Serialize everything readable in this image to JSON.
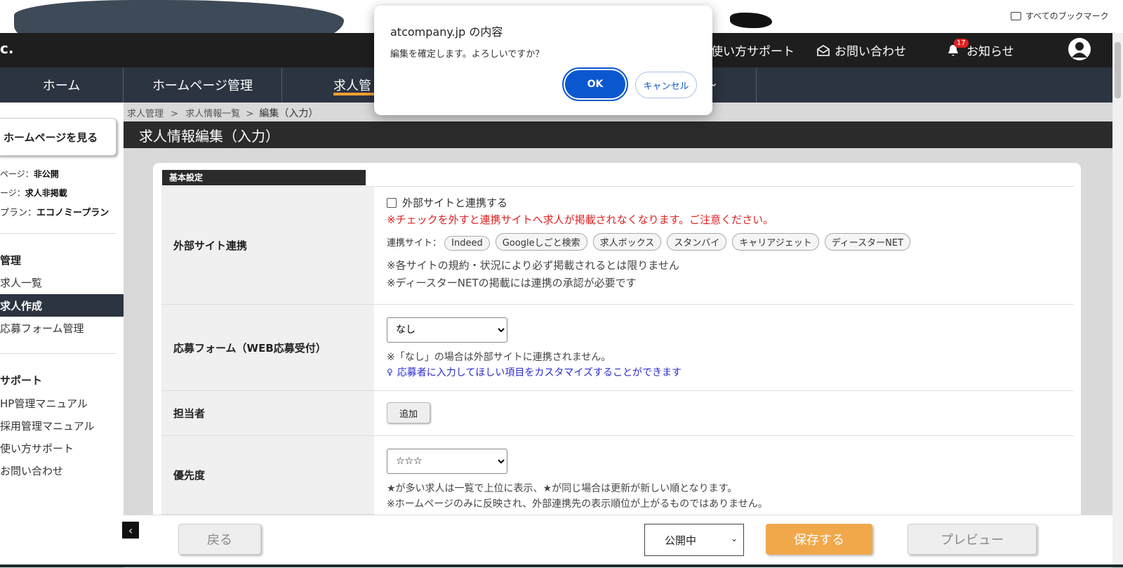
{
  "browser": {
    "bookmarks_label": "すべてのブックマーク"
  },
  "header": {
    "logo_fragment": "c.",
    "links": [
      {
        "label": "使い方サポート"
      },
      {
        "label": "お問い合わせ"
      },
      {
        "label": "お知らせ"
      }
    ],
    "notification_count": "17"
  },
  "nav": {
    "items": [
      "ホーム",
      "ホームページ管理",
      "求人管",
      "⌄"
    ]
  },
  "sidebar": {
    "view_homepage_button": "ホームページを見る",
    "status": [
      {
        "label": "ページ：",
        "value": "非公開"
      },
      {
        "label": "ージ：",
        "value": "求人非掲載"
      },
      {
        "label": "プラン：",
        "value": "エコノミープラン"
      }
    ],
    "section1_heading": "管理",
    "section1_items": [
      "求人一覧",
      "求人作成",
      "応募フォーム管理"
    ],
    "section2_heading": "サポート",
    "section2_items": [
      "HP管理マニュアル",
      "採用管理マニュアル",
      "使い方サポート",
      "お問い合わせ"
    ]
  },
  "main": {
    "breadcrumb": [
      "求人管理",
      ">",
      "求人情報一覧",
      ">",
      "編集（入力）"
    ],
    "page_title": "求人情報編集（入力）",
    "section_label": "基本設定",
    "rows": {
      "external": {
        "label": "外部サイト連携",
        "checkbox_label": "外部サイトと連携する",
        "warning": "※チェックを外すと連携サイトへ求人が掲載されなくなります。ご注意ください。",
        "sites_label": "連携サイト：",
        "sites": [
          "Indeed",
          "Googleしごと検索",
          "求人ボックス",
          "スタンバイ",
          "キャリアジェット",
          "ディースターNET"
        ],
        "note1": "※各サイトの規約・状況により必ず掲載されるとは限りません",
        "note2": "※ディースターNETの掲載には連携の承認が必要です"
      },
      "form": {
        "label": "応募フォーム（WEB応募受付）",
        "select_value": "なし",
        "note": "※「なし」の場合は外部サイトに連携されません。",
        "link": "応募者に入力してほしい項目をカスタマイズすることができます"
      },
      "owner": {
        "label": "担当者",
        "button": "追加"
      },
      "priority": {
        "label": "優先度",
        "select_value": "☆☆☆",
        "note1": "★が多い求人は一覧で上位に表示、★が同じ場合は更新が新しい順となります。",
        "note2": "※ホームページのみに反映され、外部連携先の表示順位が上がるものではありません。"
      }
    }
  },
  "footer": {
    "back": "戻る",
    "status_select": "公開中",
    "save": "保存する",
    "preview": "プレビュー"
  },
  "dialog": {
    "title": "atcompany.jp の内容",
    "message": "編集を確定します。よろしいですか？",
    "ok": "OK",
    "cancel": "キャンセル"
  },
  "colors": {
    "accent": "#f0a030",
    "dialog_primary": "#0b57d0",
    "warning": "#e02020",
    "link": "#2a2ad0"
  }
}
